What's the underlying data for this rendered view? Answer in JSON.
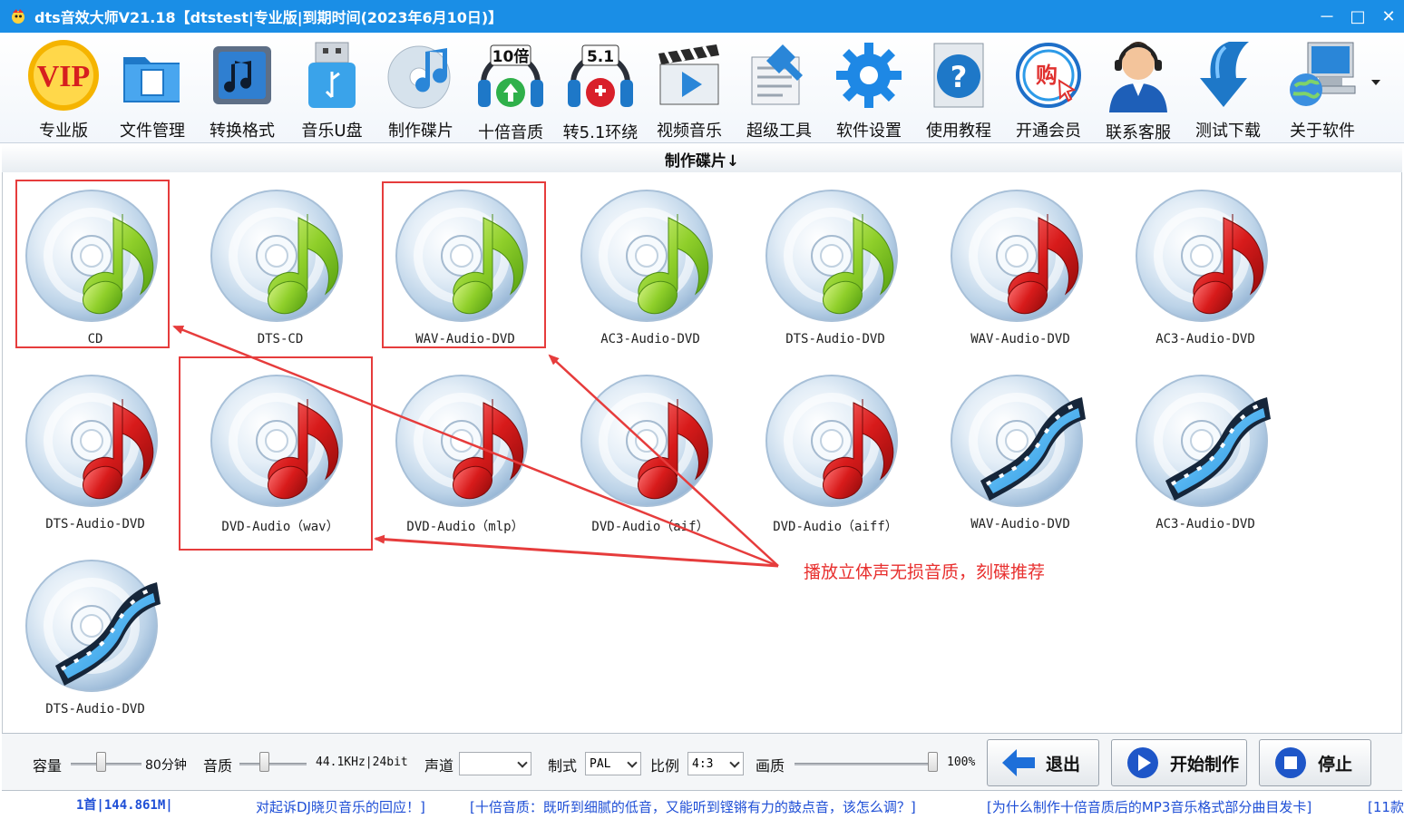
{
  "window": {
    "title": "dts音效大师V21.18【dtstest|专业版|到期时间(2023年6月10日)】",
    "controls": [
      "－",
      "□",
      "✕"
    ]
  },
  "toolbar": {
    "items": [
      {
        "label": "专业版",
        "icon": "vip-icon"
      },
      {
        "label": "文件管理",
        "icon": "folder-icon"
      },
      {
        "label": "转换格式",
        "icon": "music-convert-icon"
      },
      {
        "label": "音乐U盘",
        "icon": "usb-drive-icon"
      },
      {
        "label": "制作碟片",
        "icon": "disc-music-icon"
      },
      {
        "label": "十倍音质",
        "icon": "headphone-10x-icon",
        "badge": "10倍"
      },
      {
        "label": "转5.1环绕",
        "icon": "headphone-51-icon",
        "badge": "5.1"
      },
      {
        "label": "视频音乐",
        "icon": "clapperboard-icon"
      },
      {
        "label": "超级工具",
        "icon": "tools-icon"
      },
      {
        "label": "软件设置",
        "icon": "gear-icon"
      },
      {
        "label": "使用教程",
        "icon": "help-icon"
      },
      {
        "label": "开通会员",
        "icon": "shop-icon",
        "badge": "购"
      },
      {
        "label": "联系客服",
        "icon": "support-agent-icon"
      },
      {
        "label": "测试下载",
        "icon": "download-arrow-icon"
      },
      {
        "label": "关于软件",
        "icon": "computer-icon"
      }
    ]
  },
  "section": {
    "title": "制作碟片↓"
  },
  "discs": [
    {
      "label": "CD",
      "kind": "green-note"
    },
    {
      "label": "DTS-CD",
      "kind": "green-note"
    },
    {
      "label": "WAV-Audio-DVD",
      "kind": "green-note"
    },
    {
      "label": "AC3-Audio-DVD",
      "kind": "green-note"
    },
    {
      "label": "DTS-Audio-DVD",
      "kind": "green-note"
    },
    {
      "label": "WAV-Audio-DVD",
      "kind": "red-note"
    },
    {
      "label": "AC3-Audio-DVD",
      "kind": "red-note"
    },
    {
      "label": "DTS-Audio-DVD",
      "kind": "red-note"
    },
    {
      "label": "DVD-Audio（wav）",
      "kind": "red-note"
    },
    {
      "label": "DVD-Audio（mlp）",
      "kind": "red-note"
    },
    {
      "label": "DVD-Audio（aif）",
      "kind": "red-note"
    },
    {
      "label": "DVD-Audio（aiff）",
      "kind": "red-note"
    },
    {
      "label": "WAV-Audio-DVD",
      "kind": "film"
    },
    {
      "label": "AC3-Audio-DVD",
      "kind": "film"
    },
    {
      "label": "DTS-Audio-DVD",
      "kind": "film"
    }
  ],
  "annotation": {
    "text": "播放立体声无损音质，刻碟推荐"
  },
  "controls": {
    "capacity_label": "容量",
    "capacity_value": "80分钟",
    "quality_label": "音质",
    "quality_value": "44.1KHz|24bit",
    "channel_label": "声道",
    "channel_value": "",
    "system_label": "制式",
    "system_value": "PAL",
    "ratio_label": "比例",
    "ratio_value": "4:3",
    "picture_label": "画质",
    "picture_value": "100%",
    "exit_label": "退出",
    "start_label": "开始制作",
    "stop_label": "停止",
    "capacity_level": 0.42,
    "quality_level": 0.35,
    "picture_level": 1.0
  },
  "status": {
    "count": "1首|144.861M|",
    "links": [
      "对起诉DJ晓贝音乐的回应！]",
      "[十倍音质：既听到细腻的低音，又能听到铿锵有力的鼓点音，该怎么调？]",
      "[为什么制作十倍音质后的MP3音乐格式部分曲目发卡]",
      "[11款"
    ]
  },
  "colors": {
    "titlebar": "#1a8ee6",
    "highlight": "#e63c3c",
    "status_text": "#1f4fd6"
  }
}
